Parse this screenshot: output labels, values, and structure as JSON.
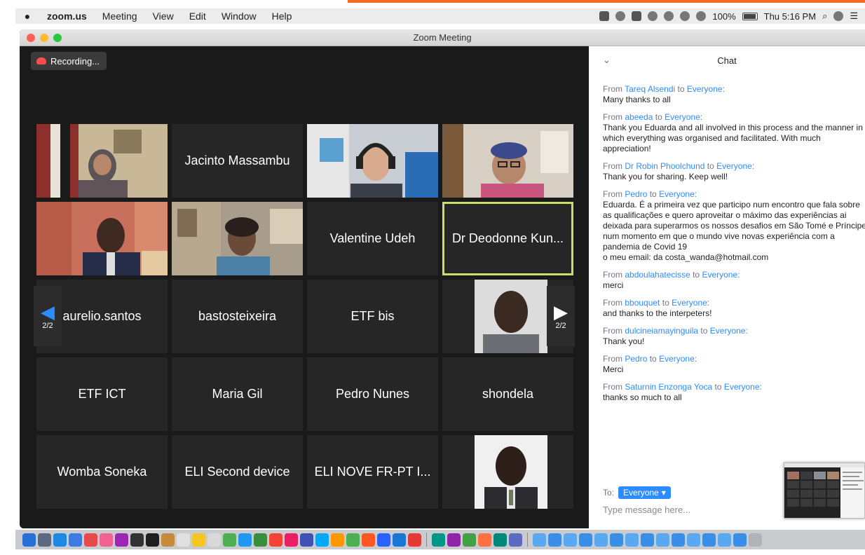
{
  "menubar": {
    "app": "zoom.us",
    "items": [
      "Meeting",
      "View",
      "Edit",
      "Window",
      "Help"
    ],
    "battery": "100%",
    "clock": "Thu 5:16 PM"
  },
  "window": {
    "title": "Zoom Meeting"
  },
  "recording": {
    "label": "Recording..."
  },
  "pager": {
    "left": "2/2",
    "right": "2/2"
  },
  "tiles": [
    {
      "name": "",
      "video": "video-woman-flag"
    },
    {
      "name": "Jacinto Massambu"
    },
    {
      "name": "",
      "video": "video-man-headphones"
    },
    {
      "name": "",
      "video": "video-woman-glasses"
    },
    {
      "name": "",
      "video": "video-man-suit"
    },
    {
      "name": "",
      "video": "video-woman-room"
    },
    {
      "name": "Valentine Udeh"
    },
    {
      "name": "Dr Deodonne Kun...",
      "active": true
    },
    {
      "name": "aurelio.santos"
    },
    {
      "name": "bastosteixeira"
    },
    {
      "name": "ETF bis"
    },
    {
      "name": "",
      "video": "profile-photo-man"
    },
    {
      "name": "ETF ICT"
    },
    {
      "name": "Maria Gil"
    },
    {
      "name": "Pedro Nunes"
    },
    {
      "name": "shondela"
    },
    {
      "name": "Womba Soneka"
    },
    {
      "name": "ELI Second device"
    },
    {
      "name": "ELI NOVE FR-PT I..."
    },
    {
      "name": "",
      "video": "profile-photo-man-tie"
    }
  ],
  "chat": {
    "title": "Chat",
    "from_label": "From",
    "to_word": "to",
    "messages": [
      {
        "from": "Tareq Alsendi",
        "to": "Everyone:",
        "text": "Many thanks to all"
      },
      {
        "from": "abeeda",
        "to": "Everyone:",
        "text": "Thank you Eduarda and all involved in this process and the manner in which everything was organised and facilitated. With much appreciation!"
      },
      {
        "from": "Dr Robin Phoolchund",
        "to": "Everyone:",
        "text": "Thank you for sharing. Keep well!"
      },
      {
        "from": "Pedro",
        "to": "Everyone:",
        "text": "Eduarda. É a primeira vez que participo num encontro que fala sobre as qualificações e quero aproveitar o máximo das experiências ai deixada para superarmos os nossos desafios em São Tomé e Príncipe num momento em que o mundo vive novas experiência com a pandemia de Covid 19",
        "text2": "o meu email: da costa_wanda@hotmail.com"
      },
      {
        "from": "abdoulahatecisse",
        "to": "Everyone:",
        "text": "merci"
      },
      {
        "from": "bbouquet",
        "to": "Everyone:",
        "text": "and thanks to the interpeters!"
      },
      {
        "from": "dulcineiamayinguila",
        "to": "Everyone:",
        "text": "Thank you!"
      },
      {
        "from": "Pedro",
        "to": "Everyone:",
        "text": "Merci"
      },
      {
        "from": "Saturnin Enzonga Yoca",
        "to": "Everyone:",
        "text": "thanks so much to all"
      }
    ],
    "to_label": "To:",
    "recipient": "Everyone",
    "input_placeholder": "Type message here..."
  },
  "colors": {
    "accent": "#2d8cff",
    "active_speaker": "#c5df68",
    "recording": "#ff4d4d",
    "tile_bg": "#262626"
  }
}
